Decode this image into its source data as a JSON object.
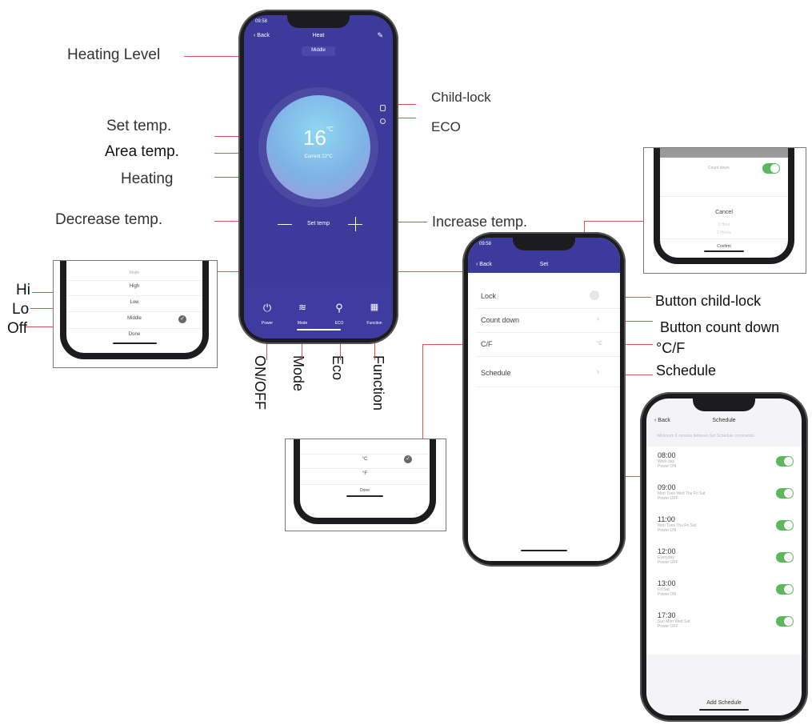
{
  "labels": {
    "heating_level": "Heating Level",
    "set_temp": "Set temp.",
    "area_temp": "Area temp.",
    "heating": "Heating",
    "decrease_temp": "Decrease temp.",
    "increase_temp": "Increase temp.",
    "child_lock": "Child-lock",
    "eco": "ECO",
    "hi": "Hi",
    "lo": "Lo",
    "off": "Off",
    "on_off": "ON/OFF",
    "mode": "Mode",
    "eco_btn": "Eco",
    "function": "Function",
    "button_child_lock": "Button child-lock",
    "button_count_down": "Button count down",
    "cf": "°C/F",
    "schedule": "Schedule"
  },
  "heat_phone": {
    "status_time": "09:58",
    "back": "Back",
    "title": "Heat",
    "level": "Middle",
    "temp_value": "16",
    "temp_unit": "°C",
    "current": "Current 22°C",
    "set_temp": "Set temp",
    "bottom_buttons": [
      "Power",
      "Mode",
      "ECO",
      "Function"
    ]
  },
  "mode_popup": {
    "title": "Mode",
    "options": [
      "High",
      "Low",
      "Middle"
    ],
    "done": "Done"
  },
  "countdown_popup": {
    "item": "Count down",
    "cancel": "Cancel",
    "option1": "1 Hour",
    "option2": "2 Hours",
    "confirm": "Confirm"
  },
  "set_phone": {
    "status_time": "09:58",
    "back": "Back",
    "title": "Set",
    "rows": [
      "Lock",
      "Count down",
      "C/F",
      "Schedule"
    ],
    "cf_value": "°C"
  },
  "cf_popup": {
    "options": [
      "°C",
      "°F"
    ],
    "done": "Done"
  },
  "schedule_phone": {
    "back": "Back",
    "title": "Schedule",
    "note": "Minimum 5 minutes between Set Schedule commands.",
    "items": [
      {
        "time": "08:00",
        "days": "Work day",
        "action": "Power ON"
      },
      {
        "time": "09:00",
        "days": "Mon Tues Wed Thu Fri Sat",
        "action": "Power OFF"
      },
      {
        "time": "11:00",
        "days": "Mon Tues Thu Fri Sat",
        "action": "Power ON"
      },
      {
        "time": "12:00",
        "days": "Everyday",
        "action": "Power OFF"
      },
      {
        "time": "13:00",
        "days": "Fri Sat",
        "action": "Power ON"
      },
      {
        "time": "17:30",
        "days": "Sun Mon Wed Sat",
        "action": "Power OFF"
      }
    ],
    "add": "Add Schedule"
  },
  "colors": {
    "heat_bg": "#3c3a9a",
    "accent_line": "#d9534f",
    "toggle": "#5cb85c"
  }
}
